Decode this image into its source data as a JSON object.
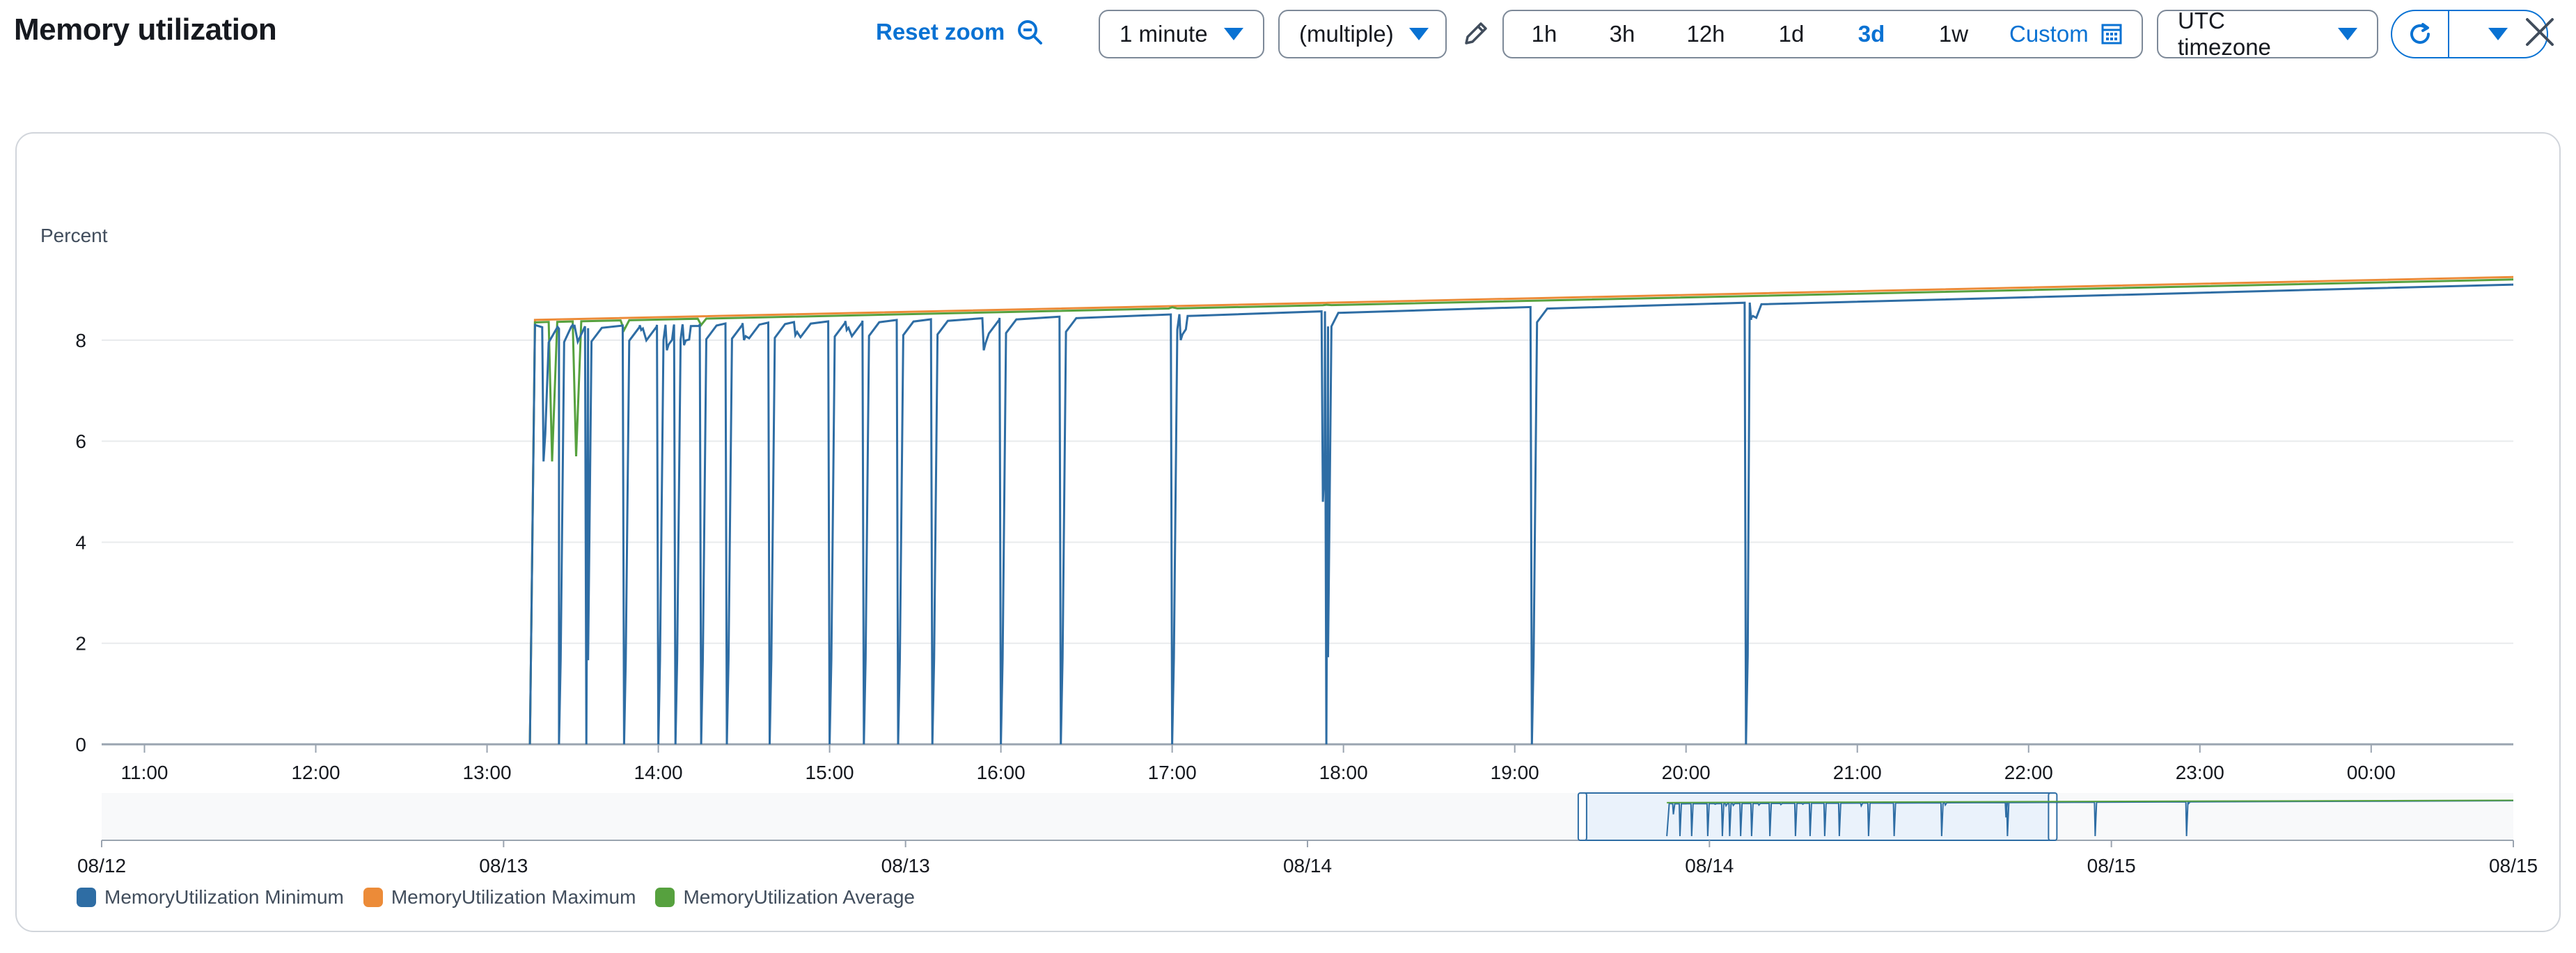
{
  "header": {
    "title": "Memory utilization",
    "reset_zoom": "Reset zoom",
    "period": "1 minute",
    "statistic": "(multiple)",
    "ranges": [
      "1h",
      "3h",
      "12h",
      "1d",
      "3d",
      "1w"
    ],
    "active_range": "3d",
    "custom_label": "Custom",
    "timezone": "UTC timezone"
  },
  "colors": {
    "accent": "#0972d3",
    "minimum": "#2e6da4",
    "maximum": "#ec8b38",
    "average": "#56a13e"
  },
  "chart_data": {
    "type": "line",
    "ylabel": "Percent",
    "ylim": [
      0,
      9.5
    ],
    "y_ticks": [
      0,
      2,
      4,
      6,
      8
    ],
    "x_tick_labels": [
      "11:00",
      "12:00",
      "13:00",
      "14:00",
      "15:00",
      "16:00",
      "17:00",
      "18:00",
      "19:00",
      "20:00",
      "21:00",
      "22:00",
      "23:00",
      "00:00"
    ],
    "x_range_hours": [
      10.75,
      24.83
    ],
    "series_start_hour": 13.25,
    "series": [
      {
        "name": "MemoryUtilization Minimum",
        "start_value": 8.3,
        "end_value": 9.1,
        "drops_to_zero_at_hours": [
          13.42,
          13.58,
          13.8,
          14.0,
          14.1,
          14.25,
          14.4,
          14.65,
          15.0,
          15.2,
          15.4,
          15.6,
          16.0,
          16.35,
          17.0,
          17.9,
          19.1,
          20.35
        ],
        "partial_dips": [
          [
            13.33,
            5.6
          ],
          [
            13.5,
            8.3
          ],
          [
            13.9,
            8.2
          ],
          [
            14.05,
            7.8
          ],
          [
            14.15,
            7.9
          ],
          [
            14.5,
            8.0
          ],
          [
            14.8,
            8.1
          ],
          [
            15.1,
            8.2
          ],
          [
            15.9,
            7.8
          ],
          [
            17.05,
            8.0
          ],
          [
            17.88,
            4.8
          ],
          [
            20.38,
            8.4
          ]
        ]
      },
      {
        "name": "MemoryUtilization Maximum",
        "start_value": 8.4,
        "end_value": 9.25
      },
      {
        "name": "MemoryUtilization Average",
        "start_value": 8.35,
        "end_value": 9.2,
        "dips": [
          [
            13.38,
            5.6
          ],
          [
            13.52,
            5.7
          ],
          [
            13.8,
            8.2
          ],
          [
            14.25,
            8.3
          ],
          [
            17.0,
            8.65
          ],
          [
            17.9,
            8.7
          ]
        ]
      }
    ],
    "navigator": {
      "date_labels": [
        "08/12",
        "08/13",
        "08/13",
        "08/14",
        "08/14",
        "08/15",
        "08/15"
      ],
      "selection_start_fraction": 0.614,
      "selection_end_fraction": 0.809
    },
    "legend_position": "bottom-left"
  }
}
